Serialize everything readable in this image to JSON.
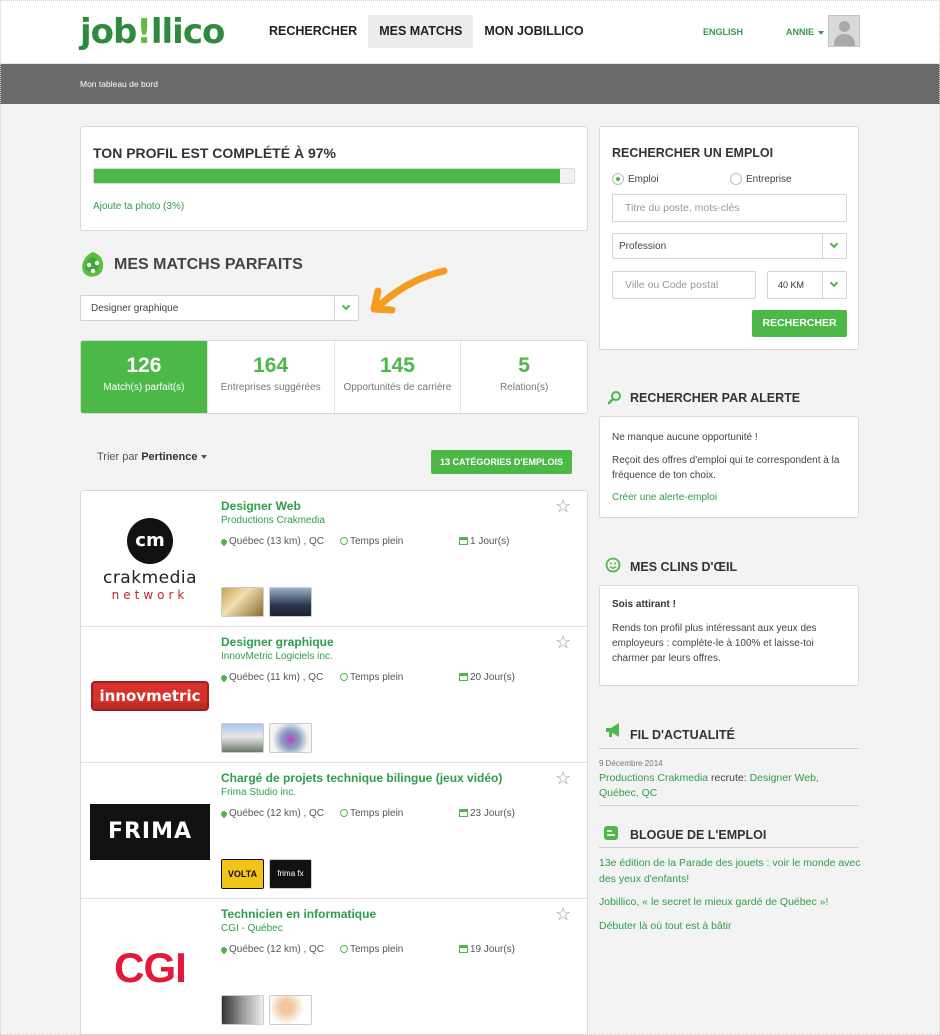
{
  "header": {
    "logo_prefix": "job",
    "logo_bang": "!",
    "logo_suffix": "llico",
    "nav": [
      "RECHERCHER",
      "MES MATCHS",
      "MON JOBILLICO"
    ],
    "nav_active": "MES MATCHS",
    "language": "ENGLISH",
    "user": "ANNIE"
  },
  "breadcrumb": "Mon tableau de bord",
  "profile": {
    "title": "TON PROFIL EST COMPLÉTÉ À 97%",
    "completion_percent": 97,
    "add_photo": "Ajoute ta photo (3%)"
  },
  "matchs": {
    "title": "MES MATCHS PARFAITS",
    "selected_job": "Designer graphique"
  },
  "stats": [
    {
      "value": "126",
      "label": "Match(s) parfait(s)",
      "active": true
    },
    {
      "value": "164",
      "label": "Entreprises suggérées",
      "active": false
    },
    {
      "value": "145",
      "label": "Opportunités de carrière",
      "active": false
    },
    {
      "value": "5",
      "label": "Relation(s)",
      "active": false
    }
  ],
  "sort": {
    "prefix": "Trier par",
    "value": "Pertinence"
  },
  "categories_button": "13 CATÉGORIES D'EMPLOIS",
  "jobs": [
    {
      "title": "Designer Web",
      "company": "Productions Crakmedia",
      "location": "Québec (13 km) , QC",
      "type": "Temps plein",
      "age": "1 Jour(s)",
      "logo": "crakmedia"
    },
    {
      "title": "Designer graphique",
      "company": "InnovMetric Logiciels inc.",
      "location": "Québec (11 km) , QC",
      "type": "Temps plein",
      "age": "20 Jour(s)",
      "logo": "innovmetric"
    },
    {
      "title": "Chargé de projets technique bilingue (jeux vidéo)",
      "company": "Frima Studio inc.",
      "location": "Québec (12 km) , QC",
      "type": "Temps plein",
      "age": "23 Jour(s)",
      "logo": "frima"
    },
    {
      "title": "Technicien en informatique",
      "company": "CGI - Québec",
      "location": "Québec (12 km) , QC",
      "type": "Temps plein",
      "age": "19 Jour(s)",
      "logo": "cgi"
    }
  ],
  "logos": {
    "crakmedia_mark": "cm",
    "crakmedia_name": "crakmedia",
    "crakmedia_sub": "network",
    "innovmetric": "innovmetric",
    "frima": "FRIMA",
    "cgi": "CGI",
    "volta": "VOLTA",
    "frimafx": "frima fx"
  },
  "search": {
    "title": "RECHERCHER UN EMPLOI",
    "radio_emploi": "Emploi",
    "radio_entreprise": "Entreprise",
    "keywords_placeholder": "Titre du poste, mots-clés",
    "profession": "Profession",
    "postal_placeholder": "Ville ou Code postal",
    "distance": "40 KM",
    "button": "RECHERCHER"
  },
  "alert": {
    "title": "RECHERCHER PAR ALERTE",
    "line1": "Ne manque aucune opportunité !",
    "line2": "Reçoit des offres d'emploi qui te correspondent à la fréquence de ton choix.",
    "link": "Créer une alerte-emploi"
  },
  "clins": {
    "title": "MES CLINS D'ŒIL",
    "heading": "Sois attirant !",
    "text": "Rends ton profil plus intéressant aux yeux des employeurs : complète-le à 100% et laisse-toi charmer par leurs offres."
  },
  "feed": {
    "title": "FIL D'ACTUALITÉ",
    "date": "9 Décembre 2014",
    "company": "Productions Crakmedia",
    "verb": " recrute: ",
    "job": "Designer Web, Québec, QC"
  },
  "blog": {
    "title": "BLOGUE DE L'EMPLOI",
    "posts": [
      "13e édition de la Parade des jouets : voir le monde avec des yeux d'enfants!",
      "Jobillico, « le secret le mieux gardé de Québec »!",
      "Débuter là où tout est à bâtir"
    ]
  },
  "colors": {
    "brand_green": "#4cb848",
    "link_green": "#2e9e4a",
    "arrow_orange": "#f39c1f",
    "subbar_gray": "#6b6b6b"
  }
}
